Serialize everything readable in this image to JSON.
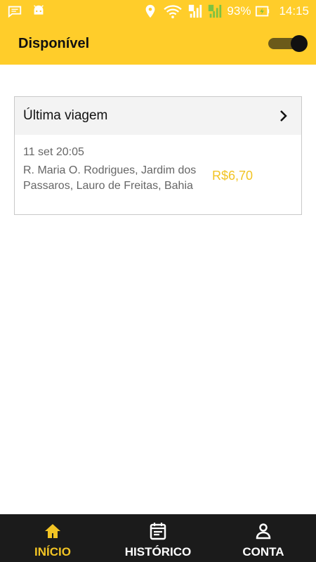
{
  "status_bar": {
    "battery": "93%",
    "time": "14:15",
    "left_icons": [
      "chat-bubble-icon",
      "android-icon"
    ],
    "right_icons": [
      "location-icon",
      "wifi-icon",
      "signal-sim1-icon",
      "signal-sim2-icon",
      "battery-charging-icon"
    ]
  },
  "app_bar": {
    "title": "Disponível",
    "toggle_on": true
  },
  "last_trip": {
    "header": "Última viagem",
    "date": "11 set 20:05",
    "address": "R. Maria O. Rodrigues, Jardim dos Passaros, Lauro de Freitas, Bahia",
    "price": "R$6,70"
  },
  "bottom_nav": {
    "items": [
      {
        "label": "INÍCIO",
        "icon": "home-icon",
        "active": true
      },
      {
        "label": "HISTÓRICO",
        "icon": "calendar-icon",
        "active": false
      },
      {
        "label": "CONTA",
        "icon": "person-icon",
        "active": false
      }
    ]
  },
  "colors": {
    "primary": "#FFCD2A",
    "accent": "#F2C424",
    "nav_background": "#1b1b1b"
  }
}
